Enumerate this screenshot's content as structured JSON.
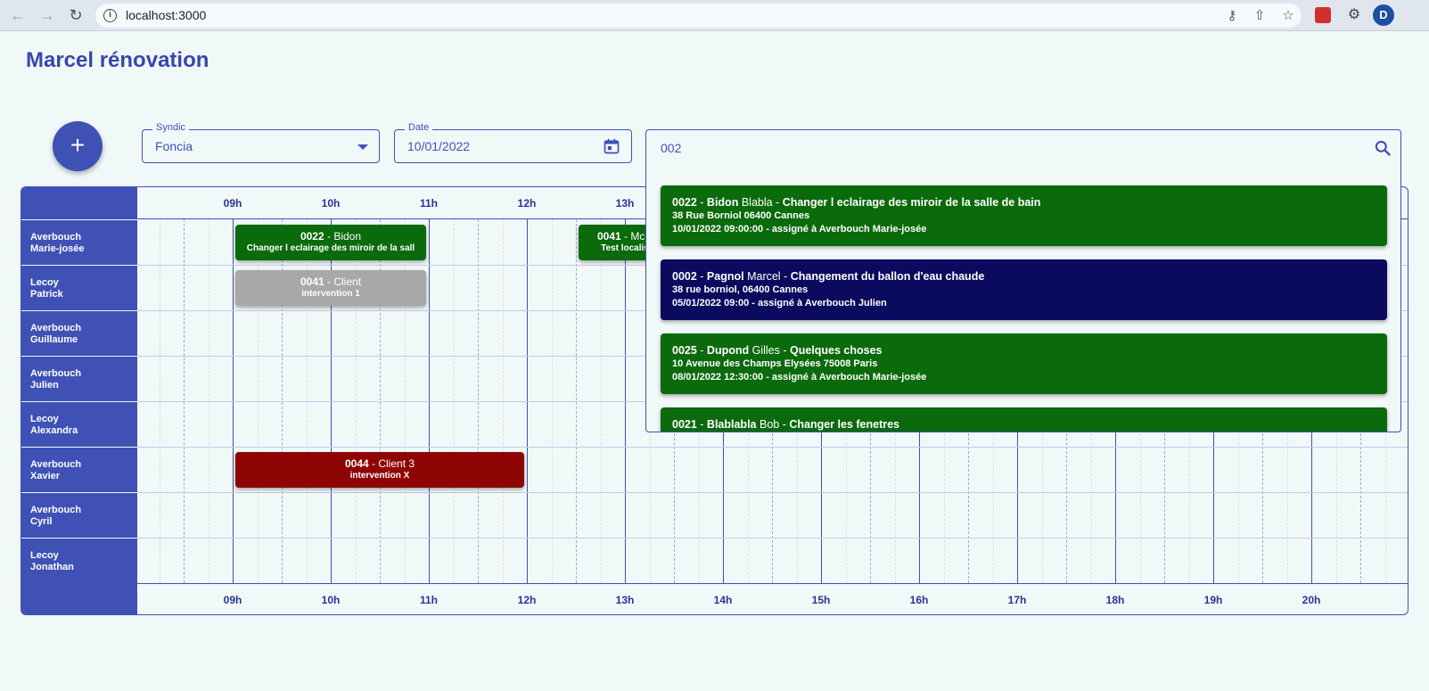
{
  "browser": {
    "url": "localhost:3000",
    "profile_initial": "D"
  },
  "app": {
    "title": "Marcel rénovation",
    "add_button_icon": "plus-icon"
  },
  "filters": {
    "syndic": {
      "label": "Syndic",
      "value": "Foncia"
    },
    "date": {
      "label": "Date",
      "value": "10/01/2022"
    }
  },
  "search": {
    "value": "002",
    "results": [
      {
        "id": "0022",
        "name": "Bidon",
        "firstname": "Blabla",
        "title": "Changer l eclairage des miroir de la salle de bain",
        "address": "38 Rue Borniol 06400 Cannes",
        "schedule": "10/01/2022 09:00:00 - assigné à Averbouch Marie-josée",
        "color": "#0b6a0b"
      },
      {
        "id": "0002",
        "name": "Pagnol",
        "firstname": "Marcel",
        "title": "Changement du ballon d'eau chaude",
        "address": "38 rue borniol, 06400 Cannes",
        "schedule": "05/01/2022 09:00 - assigné à Averbouch Julien",
        "color": "#0a0a5e"
      },
      {
        "id": "0025",
        "name": "Dupond",
        "firstname": "Gilles",
        "title": "Quelques choses",
        "address": "10 Avenue des Champs Elysées 75008 Paris",
        "schedule": "08/01/2022 12:30:00 - assigné à Averbouch Marie-josée",
        "color": "#0b6a0b"
      },
      {
        "id": "0021",
        "name": "Blablabla",
        "firstname": "Bob",
        "title": "Changer les fenetres",
        "address": "",
        "schedule": "",
        "color": "#0b6a0b"
      }
    ]
  },
  "scheduler": {
    "hours": [
      "09h",
      "10h",
      "11h",
      "12h",
      "13h",
      "14h",
      "15h",
      "16h",
      "17h",
      "18h",
      "19h",
      "20h"
    ],
    "resources": [
      {
        "line1": "Averbouch",
        "line2": "Marie-josée"
      },
      {
        "line1": "Lecoy",
        "line2": "Patrick"
      },
      {
        "line1": "Averbouch",
        "line2": "Guillaume"
      },
      {
        "line1": "Averbouch",
        "line2": "Julien"
      },
      {
        "line1": "Lecoy",
        "line2": "Alexandra"
      },
      {
        "line1": "Averbouch",
        "line2": "Xavier"
      },
      {
        "line1": "Averbouch",
        "line2": "Cyril"
      },
      {
        "line1": "Lecoy",
        "line2": "Jonathan"
      }
    ],
    "events": [
      {
        "resource": 0,
        "start": 9.0,
        "end": 11.0,
        "id": "0022",
        "client": "Bidon",
        "subtitle": "Changer l eclairage des miroir de la sall",
        "color": "#0b6a0b"
      },
      {
        "resource": 0,
        "start": 12.5,
        "end": 13.5,
        "id": "0041",
        "client": "McD",
        "subtitle": "Test localis",
        "color": "#0b6a0b"
      },
      {
        "resource": 1,
        "start": 9.0,
        "end": 11.0,
        "id": "0041",
        "client": "Client",
        "subtitle": "intervention 1",
        "color": "#a8a8a8"
      },
      {
        "resource": 5,
        "start": 9.0,
        "end": 12.0,
        "id": "0044",
        "client": "Client 3",
        "subtitle": "intervention X",
        "color": "#8f0505"
      }
    ]
  }
}
